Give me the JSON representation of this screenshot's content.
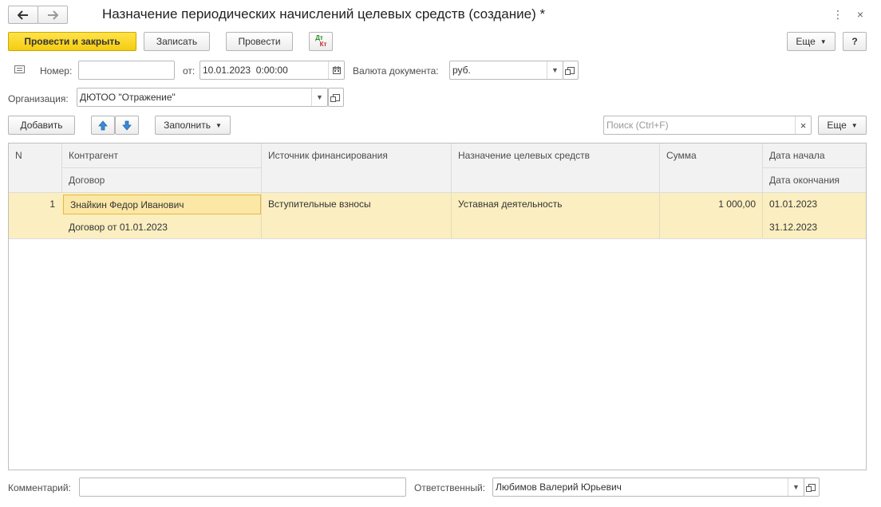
{
  "window": {
    "title": "Назначение периодических начислений целевых средств (создание) *"
  },
  "toolbar": {
    "post_close": "Провести и закрыть",
    "write": "Записать",
    "post": "Провести",
    "dtkt_top": "Дт",
    "dtkt_bottom": "Кт",
    "more": "Еще",
    "help": "?"
  },
  "header": {
    "number_label": "Номер:",
    "number_value": "",
    "from_label": "от:",
    "date_value": "10.01.2023  0:00:00",
    "currency_label": "Валюта документа:",
    "currency_value": "руб.",
    "org_label": "Организация:",
    "org_value": "ДЮТОО \"Отражение\""
  },
  "table_toolbar": {
    "add": "Добавить",
    "fill": "Заполнить",
    "search_placeholder": "Поиск (Ctrl+F)",
    "more": "Еще"
  },
  "table": {
    "columns": {
      "n": "N",
      "counterparty": "Контрагент",
      "contract": "Договор",
      "source": "Источник финансирования",
      "purpose": "Назначение целевых средств",
      "amount": "Сумма",
      "date_start": "Дата начала",
      "date_end": "Дата окончания"
    },
    "rows": [
      {
        "n": "1",
        "counterparty": "Знайкин Федор Иванович",
        "contract": "Договор от 01.01.2023",
        "source": "Вступительные взносы",
        "purpose": "Уставная деятельность",
        "amount": "1 000,00",
        "date_start": "01.01.2023",
        "date_end": "31.12.2023"
      }
    ]
  },
  "footer": {
    "comment_label": "Комментарий:",
    "comment_value": "",
    "responsible_label": "Ответственный:",
    "responsible_value": "Любимов Валерий Юрьевич"
  },
  "colors": {
    "primary_button": "#f5cc10",
    "selected_row": "#fbeec0",
    "arrow_blue": "#3a8ad8"
  }
}
